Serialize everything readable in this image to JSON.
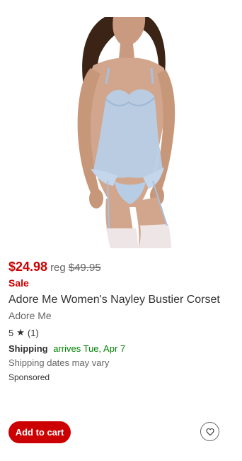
{
  "product": {
    "image_alt": "Adore Me Women's Nayley Bustier Corset",
    "price_current": "$24.98",
    "reg_label": "reg",
    "price_regular": "$49.95",
    "sale_label": "Sale",
    "title": "Adore Me Women's Nayley Bustier Corset",
    "brand": "Adore Me",
    "rating_value": "5",
    "rating_icon": "star-icon",
    "rating_count": "(1)",
    "shipping_label": "Shipping",
    "shipping_date": "arrives Tue, Apr 7",
    "shipping_note": "Shipping dates may vary",
    "sponsored_label": "Sponsored"
  },
  "actions": {
    "add_to_cart_label": "Add to cart",
    "favorite_icon": "heart-outline-icon"
  },
  "colors": {
    "price_red": "#cc0000",
    "shipping_green": "#008300",
    "text_dark": "#333333",
    "text_gray": "#666666",
    "button_red": "#cc0000"
  }
}
